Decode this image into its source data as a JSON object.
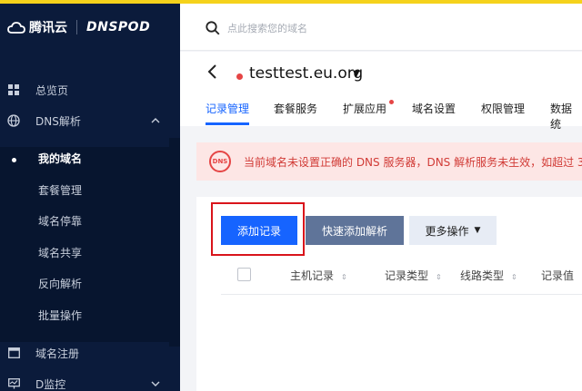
{
  "brand": {
    "tencent": "腾讯云",
    "dnspod": "DNSPOD"
  },
  "nav": {
    "overview": "总览页",
    "dns": "DNS解析",
    "sub_items": [
      "我的域名",
      "套餐管理",
      "域名停靠",
      "域名共享",
      "反向解析",
      "批量操作"
    ],
    "register": "域名注册",
    "monitor": "D监控"
  },
  "search": {
    "placeholder": "点此搜索您的域名"
  },
  "domain": {
    "name": "testtest.eu.org"
  },
  "tabs": [
    "记录管理",
    "套餐服务",
    "扩展应用",
    "域名设置",
    "权限管理",
    "数据统"
  ],
  "alert": {
    "text": "当前域名未设置正确的 DNS 服务器，DNS 解析服务未生效，如超过 3",
    "icon_text": "DNS"
  },
  "toolbar": {
    "add": "添加记录",
    "quick_add": "快速添加解析",
    "more": "更多操作"
  },
  "table": {
    "headers": [
      "主机记录",
      "记录类型",
      "线路类型",
      "记录值"
    ]
  },
  "colors": {
    "accent": "#1664ff",
    "sidebar": "#0b1b3b",
    "alert_bg": "#fde6e5",
    "alert_text": "#d13b36",
    "highlight": "#d9141b"
  }
}
